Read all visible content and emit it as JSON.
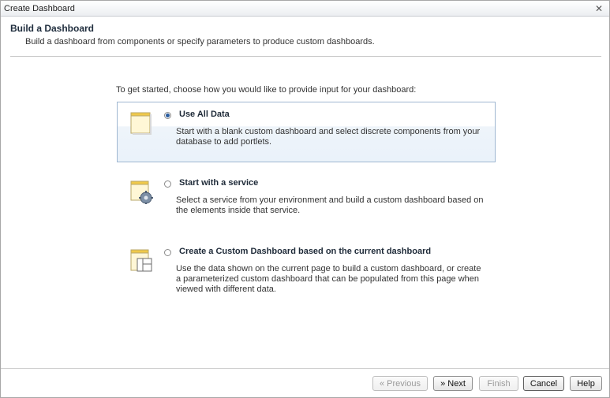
{
  "window": {
    "title": "Create Dashboard",
    "close_glyph": "✕"
  },
  "header": {
    "title": "Build a Dashboard",
    "subtitle": "Build a dashboard from components or specify parameters to produce custom dashboards."
  },
  "intro": "To get started, choose how you would like to provide input for your dashboard:",
  "options": [
    {
      "title": "Use All Data",
      "description": "Start with a blank custom dashboard and select discrete components from your database to add portlets.",
      "icon": "blank-page-icon",
      "selected": true
    },
    {
      "title": "Start with a service",
      "description": "Select a service from your environment and build a custom dashboard based on the elements inside that service.",
      "icon": "page-with-gear-icon",
      "selected": false
    },
    {
      "title": "Create a Custom Dashboard based on the current dashboard",
      "description": "Use the data shown on the current page to build a custom dashboard, or create a parameterized custom dashboard that can be populated from this page when viewed with different data.",
      "icon": "page-with-layout-icon",
      "selected": false
    }
  ],
  "buttons": {
    "previous": "« Previous",
    "next": "» Next",
    "finish": "Finish",
    "cancel": "Cancel",
    "help": "Help"
  },
  "colors": {
    "selection_border": "#9fb7d1",
    "selection_fill": "#eaf2fa",
    "radio_dot": "#2a5d9f"
  }
}
